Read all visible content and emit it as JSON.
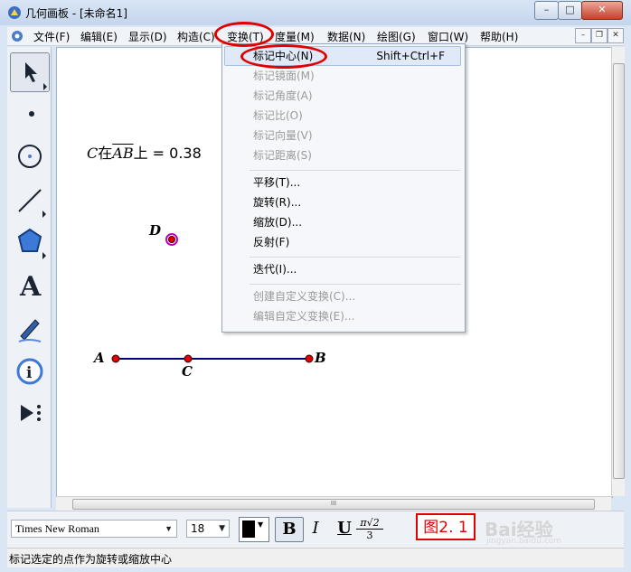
{
  "window": {
    "title": "几何画板 - [未命名1]"
  },
  "menubar": {
    "items": [
      {
        "label": "文件(F)"
      },
      {
        "label": "编辑(E)"
      },
      {
        "label": "显示(D)"
      },
      {
        "label": "构造(C)"
      },
      {
        "label": "变换(T)"
      },
      {
        "label": "度量(M)"
      },
      {
        "label": "数据(N)"
      },
      {
        "label": "绘图(G)"
      },
      {
        "label": "窗口(W)"
      },
      {
        "label": "帮助(H)"
      }
    ],
    "active": "变换(T)"
  },
  "transform_menu": {
    "items": [
      {
        "label": "标记中心(N)",
        "shortcut": "Shift+Ctrl+F",
        "enabled": true,
        "highlighted": true
      },
      {
        "label": "标记镜面(M)",
        "enabled": false
      },
      {
        "label": "标记角度(A)",
        "enabled": false
      },
      {
        "label": "标记比(O)",
        "enabled": false
      },
      {
        "label": "标记向量(V)",
        "enabled": false
      },
      {
        "label": "标记距离(S)",
        "enabled": false
      },
      {
        "label": "平移(T)...",
        "enabled": true
      },
      {
        "label": "旋转(R)...",
        "enabled": true
      },
      {
        "label": "缩放(D)...",
        "enabled": true
      },
      {
        "label": "反射(F)",
        "enabled": true
      },
      {
        "label": "迭代(I)...",
        "enabled": true
      },
      {
        "label": "创建自定义变换(C)...",
        "enabled": false
      },
      {
        "label": "编辑自定义变换(E)...",
        "enabled": false
      }
    ]
  },
  "canvas": {
    "measurement": {
      "point": "C",
      "middle": "在",
      "segment": "AB",
      "suffix": "上 = 0.38"
    },
    "points": [
      {
        "label": "D"
      },
      {
        "label": "A"
      },
      {
        "label": "C"
      },
      {
        "label": "B"
      }
    ]
  },
  "toolbox": {
    "tools": [
      "arrow-select-icon",
      "point-icon",
      "compass-icon",
      "straightedge-icon",
      "polygon-icon",
      "text-icon",
      "marker-icon",
      "info-icon",
      "custom-tool-icon"
    ]
  },
  "format_bar": {
    "font": "Times New Roman",
    "size": "18",
    "bold": "B",
    "italic": "I",
    "underline": "U",
    "math_top": "π√2",
    "math_bottom": "3",
    "figure_label": "图2. 1",
    "watermark": "Bai经验",
    "watermark_url": "jingyan.baidu.com"
  },
  "statusbar": {
    "text": "标记选定的点作为旋转或缩放中心"
  },
  "colors": {
    "highlight": "#dfe9f7",
    "annotation_red": "#e00000",
    "segment_blue": "#000080",
    "point_red": "#e00000",
    "point_magenta": "#c000c0"
  }
}
